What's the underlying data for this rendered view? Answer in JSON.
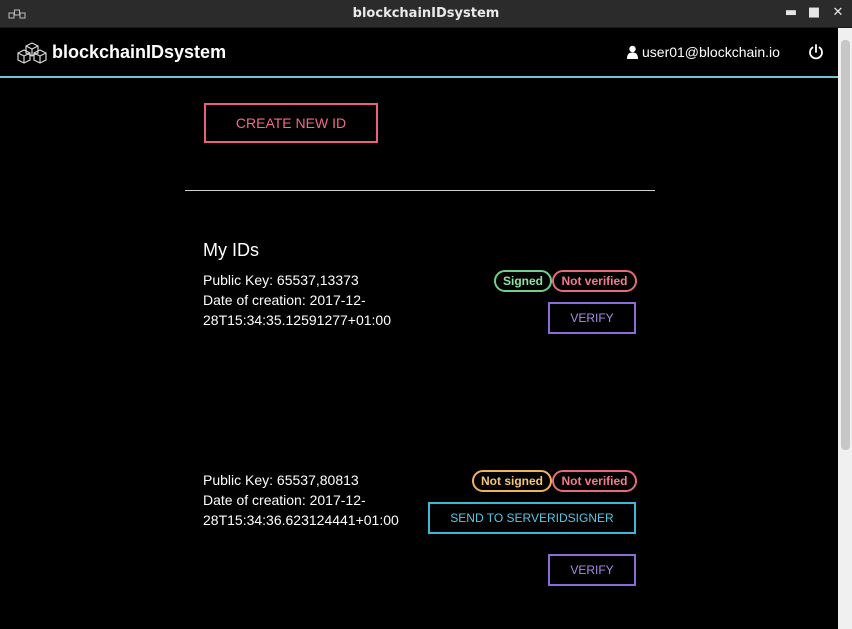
{
  "window": {
    "title": "blockchainIDsystem",
    "controls": {
      "minimize": "▬",
      "maximize": "■",
      "close": "✕"
    }
  },
  "header": {
    "brand": "blockchainIDsystem",
    "user_email": "user01@blockchain.io",
    "icons": {
      "brand": "cubes-icon",
      "user": "user-icon",
      "logout": "power-icon"
    }
  },
  "actions": {
    "create_new_id": "CREATE NEW ID"
  },
  "my_ids": {
    "title": "My IDs",
    "items": [
      {
        "public_key": "Public Key: 65537,13373",
        "date_line1": "Date of creation: 2017-12-",
        "date_line2": "28T15:34:35.12591277+01:00",
        "sign_status": "Signed",
        "verify_status": "Not verified",
        "verify_label": "VERIFY"
      },
      {
        "public_key": "Public Key: 65537,80813",
        "date_line1": "Date of creation: 2017-12-",
        "date_line2": "28T15:34:36.623124441+01:00",
        "sign_status": "Not signed",
        "verify_status": "Not verified",
        "send_label": "SEND TO SERVERIDSIGNER",
        "verify_label": "VERIFY"
      }
    ]
  },
  "colors": {
    "header_rule": "#6ec6d8",
    "create_button": "#e8607a",
    "signed": "#6fd08a",
    "not_signed": "#f2b25a",
    "not_verified": "#e66a7b",
    "verify_button": "#8c6bd6",
    "send_button": "#3ab8d8"
  }
}
